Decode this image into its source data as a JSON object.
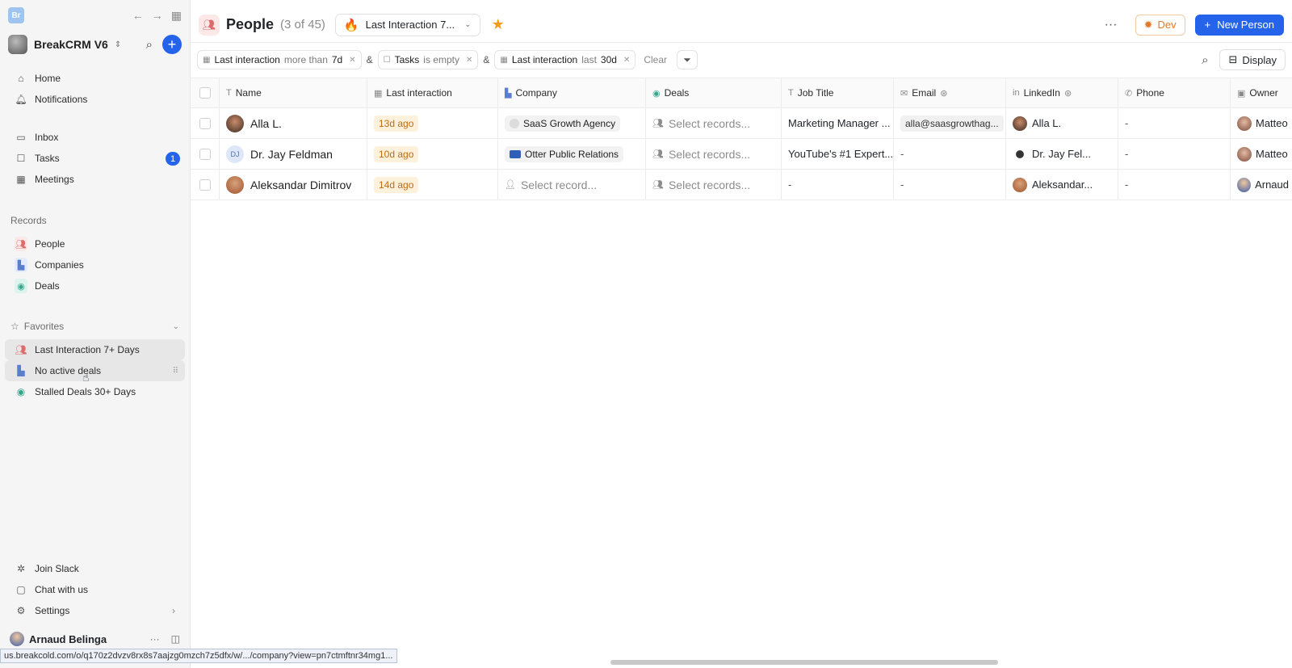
{
  "sidebar": {
    "app_logo": "Br",
    "workspace_name": "BreakCRM V6",
    "nav": [
      {
        "label": "Home",
        "icon": "home-icon"
      },
      {
        "label": "Notifications",
        "icon": "bell-icon"
      }
    ],
    "nav2": [
      {
        "label": "Inbox",
        "icon": "inbox-icon"
      },
      {
        "label": "Tasks",
        "icon": "clipboard-icon",
        "badge": "1"
      },
      {
        "label": "Meetings",
        "icon": "calendar-icon"
      }
    ],
    "records_label": "Records",
    "records": [
      {
        "label": "People"
      },
      {
        "label": "Companies"
      },
      {
        "label": "Deals"
      }
    ],
    "favorites_label": "Favorites",
    "favorites": [
      {
        "label": "Last Interaction 7+ Days"
      },
      {
        "label": "No active deals"
      },
      {
        "label": "Stalled Deals 30+ Days"
      }
    ],
    "bottom": [
      {
        "label": "Join Slack"
      },
      {
        "label": "Chat with us"
      },
      {
        "label": "Settings"
      }
    ],
    "user_name": "Arnaud Belinga"
  },
  "header": {
    "title": "People",
    "count": "(3 of 45)",
    "view_name": "Last Interaction 7...",
    "dev_label": "Dev",
    "new_label": "New Person"
  },
  "filters": {
    "chips": [
      {
        "field": "Last interaction",
        "op": "more than",
        "value": "7d"
      },
      {
        "field": "Tasks",
        "op": "is empty",
        "value": ""
      },
      {
        "field": "Last interaction",
        "op": "last",
        "value": "30d"
      }
    ],
    "amp": "&",
    "clear_label": "Clear",
    "display_label": "Display"
  },
  "table": {
    "columns": [
      "Name",
      "Last interaction",
      "Company",
      "Deals",
      "Job Title",
      "Email",
      "LinkedIn",
      "Phone",
      "Owner"
    ],
    "rows": [
      {
        "name": "Alla L.",
        "last": "13d ago",
        "company": "SaaS Growth Agency",
        "deals": "Select records...",
        "job": "Marketing Manager ...",
        "email": "alla@saasgrowthag...",
        "linkedin": "Alla L.",
        "phone": "-",
        "owner": "Matteo"
      },
      {
        "name": "Dr. Jay Feldman",
        "initials": "DJ",
        "last": "10d ago",
        "company": "Otter Public Relations",
        "deals": "Select records...",
        "job": "YouTube's #1 Expert...",
        "email": "-",
        "linkedin": "Dr. Jay Fel...",
        "phone": "-",
        "owner": "Matteo"
      },
      {
        "name": "Aleksandar Dimitrov",
        "last": "14d ago",
        "company": "Select record...",
        "deals": "Select records...",
        "job": "-",
        "email": "-",
        "linkedin": "Aleksandar...",
        "phone": "-",
        "owner": "Arnaud"
      }
    ]
  },
  "status_url": "us.breakcold.com/o/q170z2dvzv8rx8s7aajzg0mzch7z5dfx/w/.../company?view=pn7ctmftnr34mg1..."
}
